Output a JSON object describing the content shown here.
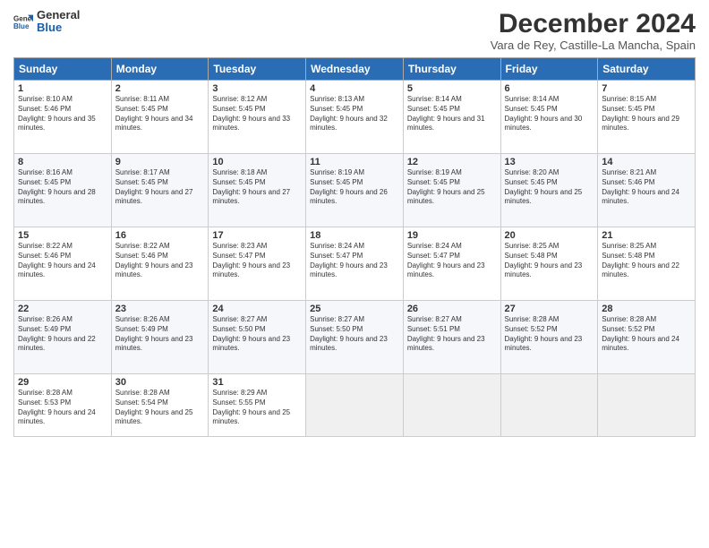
{
  "header": {
    "logo_line1": "General",
    "logo_line2": "Blue",
    "month": "December 2024",
    "location": "Vara de Rey, Castille-La Mancha, Spain"
  },
  "days_of_week": [
    "Sunday",
    "Monday",
    "Tuesday",
    "Wednesday",
    "Thursday",
    "Friday",
    "Saturday"
  ],
  "weeks": [
    [
      {
        "day": "1",
        "sunrise": "Sunrise: 8:10 AM",
        "sunset": "Sunset: 5:46 PM",
        "daylight": "Daylight: 9 hours and 35 minutes."
      },
      {
        "day": "2",
        "sunrise": "Sunrise: 8:11 AM",
        "sunset": "Sunset: 5:45 PM",
        "daylight": "Daylight: 9 hours and 34 minutes."
      },
      {
        "day": "3",
        "sunrise": "Sunrise: 8:12 AM",
        "sunset": "Sunset: 5:45 PM",
        "daylight": "Daylight: 9 hours and 33 minutes."
      },
      {
        "day": "4",
        "sunrise": "Sunrise: 8:13 AM",
        "sunset": "Sunset: 5:45 PM",
        "daylight": "Daylight: 9 hours and 32 minutes."
      },
      {
        "day": "5",
        "sunrise": "Sunrise: 8:14 AM",
        "sunset": "Sunset: 5:45 PM",
        "daylight": "Daylight: 9 hours and 31 minutes."
      },
      {
        "day": "6",
        "sunrise": "Sunrise: 8:14 AM",
        "sunset": "Sunset: 5:45 PM",
        "daylight": "Daylight: 9 hours and 30 minutes."
      },
      {
        "day": "7",
        "sunrise": "Sunrise: 8:15 AM",
        "sunset": "Sunset: 5:45 PM",
        "daylight": "Daylight: 9 hours and 29 minutes."
      }
    ],
    [
      {
        "day": "8",
        "sunrise": "Sunrise: 8:16 AM",
        "sunset": "Sunset: 5:45 PM",
        "daylight": "Daylight: 9 hours and 28 minutes."
      },
      {
        "day": "9",
        "sunrise": "Sunrise: 8:17 AM",
        "sunset": "Sunset: 5:45 PM",
        "daylight": "Daylight: 9 hours and 27 minutes."
      },
      {
        "day": "10",
        "sunrise": "Sunrise: 8:18 AM",
        "sunset": "Sunset: 5:45 PM",
        "daylight": "Daylight: 9 hours and 27 minutes."
      },
      {
        "day": "11",
        "sunrise": "Sunrise: 8:19 AM",
        "sunset": "Sunset: 5:45 PM",
        "daylight": "Daylight: 9 hours and 26 minutes."
      },
      {
        "day": "12",
        "sunrise": "Sunrise: 8:19 AM",
        "sunset": "Sunset: 5:45 PM",
        "daylight": "Daylight: 9 hours and 25 minutes."
      },
      {
        "day": "13",
        "sunrise": "Sunrise: 8:20 AM",
        "sunset": "Sunset: 5:45 PM",
        "daylight": "Daylight: 9 hours and 25 minutes."
      },
      {
        "day": "14",
        "sunrise": "Sunrise: 8:21 AM",
        "sunset": "Sunset: 5:46 PM",
        "daylight": "Daylight: 9 hours and 24 minutes."
      }
    ],
    [
      {
        "day": "15",
        "sunrise": "Sunrise: 8:22 AM",
        "sunset": "Sunset: 5:46 PM",
        "daylight": "Daylight: 9 hours and 24 minutes."
      },
      {
        "day": "16",
        "sunrise": "Sunrise: 8:22 AM",
        "sunset": "Sunset: 5:46 PM",
        "daylight": "Daylight: 9 hours and 23 minutes."
      },
      {
        "day": "17",
        "sunrise": "Sunrise: 8:23 AM",
        "sunset": "Sunset: 5:47 PM",
        "daylight": "Daylight: 9 hours and 23 minutes."
      },
      {
        "day": "18",
        "sunrise": "Sunrise: 8:24 AM",
        "sunset": "Sunset: 5:47 PM",
        "daylight": "Daylight: 9 hours and 23 minutes."
      },
      {
        "day": "19",
        "sunrise": "Sunrise: 8:24 AM",
        "sunset": "Sunset: 5:47 PM",
        "daylight": "Daylight: 9 hours and 23 minutes."
      },
      {
        "day": "20",
        "sunrise": "Sunrise: 8:25 AM",
        "sunset": "Sunset: 5:48 PM",
        "daylight": "Daylight: 9 hours and 23 minutes."
      },
      {
        "day": "21",
        "sunrise": "Sunrise: 8:25 AM",
        "sunset": "Sunset: 5:48 PM",
        "daylight": "Daylight: 9 hours and 22 minutes."
      }
    ],
    [
      {
        "day": "22",
        "sunrise": "Sunrise: 8:26 AM",
        "sunset": "Sunset: 5:49 PM",
        "daylight": "Daylight: 9 hours and 22 minutes."
      },
      {
        "day": "23",
        "sunrise": "Sunrise: 8:26 AM",
        "sunset": "Sunset: 5:49 PM",
        "daylight": "Daylight: 9 hours and 23 minutes."
      },
      {
        "day": "24",
        "sunrise": "Sunrise: 8:27 AM",
        "sunset": "Sunset: 5:50 PM",
        "daylight": "Daylight: 9 hours and 23 minutes."
      },
      {
        "day": "25",
        "sunrise": "Sunrise: 8:27 AM",
        "sunset": "Sunset: 5:50 PM",
        "daylight": "Daylight: 9 hours and 23 minutes."
      },
      {
        "day": "26",
        "sunrise": "Sunrise: 8:27 AM",
        "sunset": "Sunset: 5:51 PM",
        "daylight": "Daylight: 9 hours and 23 minutes."
      },
      {
        "day": "27",
        "sunrise": "Sunrise: 8:28 AM",
        "sunset": "Sunset: 5:52 PM",
        "daylight": "Daylight: 9 hours and 23 minutes."
      },
      {
        "day": "28",
        "sunrise": "Sunrise: 8:28 AM",
        "sunset": "Sunset: 5:52 PM",
        "daylight": "Daylight: 9 hours and 24 minutes."
      }
    ],
    [
      {
        "day": "29",
        "sunrise": "Sunrise: 8:28 AM",
        "sunset": "Sunset: 5:53 PM",
        "daylight": "Daylight: 9 hours and 24 minutes."
      },
      {
        "day": "30",
        "sunrise": "Sunrise: 8:28 AM",
        "sunset": "Sunset: 5:54 PM",
        "daylight": "Daylight: 9 hours and 25 minutes."
      },
      {
        "day": "31",
        "sunrise": "Sunrise: 8:29 AM",
        "sunset": "Sunset: 5:55 PM",
        "daylight": "Daylight: 9 hours and 25 minutes."
      },
      {
        "day": "",
        "sunrise": "",
        "sunset": "",
        "daylight": ""
      },
      {
        "day": "",
        "sunrise": "",
        "sunset": "",
        "daylight": ""
      },
      {
        "day": "",
        "sunrise": "",
        "sunset": "",
        "daylight": ""
      },
      {
        "day": "",
        "sunrise": "",
        "sunset": "",
        "daylight": ""
      }
    ]
  ]
}
